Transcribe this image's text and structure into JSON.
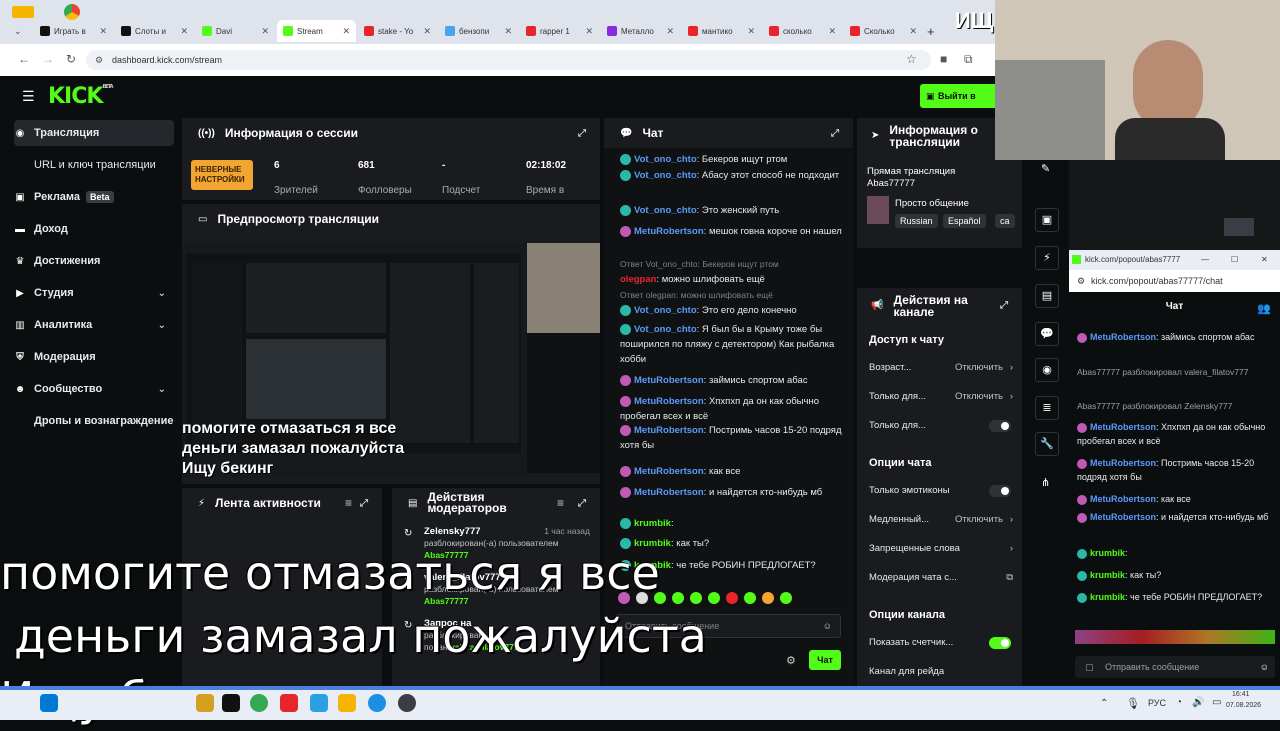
{
  "browser": {
    "tabs": [
      {
        "label": "Играть в",
        "color": "#111"
      },
      {
        "label": "Слоты и",
        "color": "#111"
      },
      {
        "label": "Davi",
        "color": "#53fc18"
      },
      {
        "label": "Stream",
        "color": "#53fc18"
      },
      {
        "label": "stake - Yo",
        "color": "#e8242c"
      },
      {
        "label": "бензопи",
        "color": "#4aa3f0"
      },
      {
        "label": "rapper 1",
        "color": "#e8242c"
      },
      {
        "label": "Металло",
        "color": "#8a2be2"
      },
      {
        "label": "мантико",
        "color": "#e8242c"
      },
      {
        "label": "сколько",
        "color": "#e8242c"
      },
      {
        "label": "Сколько",
        "color": "#e8242c"
      }
    ],
    "url": "dashboard.kick.com/stream",
    "new_tab": "+",
    "overlay_corner_text": "ИЩ"
  },
  "app": {
    "logo": "KICK",
    "logo_beta": "BETA",
    "exit_button": "Выйти в эфи",
    "sidebar": [
      {
        "label": "Трансляция",
        "icon": "broadcast-icon",
        "active": true
      },
      {
        "label": "URL и ключ трансляции",
        "icon": "",
        "active": false
      },
      {
        "label": "Реклама",
        "icon": "ads-icon",
        "badge": "Beta"
      },
      {
        "label": "Доход",
        "icon": "wallet-icon"
      },
      {
        "label": "Достижения",
        "icon": "trophy-icon"
      },
      {
        "label": "Студия",
        "icon": "studio-icon",
        "chevron": true
      },
      {
        "label": "Аналитика",
        "icon": "chart-icon",
        "chevron": true
      },
      {
        "label": "Модерация",
        "icon": "shield-icon"
      },
      {
        "label": "Сообщество",
        "icon": "community-icon",
        "chevron": true
      },
      {
        "label": "Дропы и вознаграждение",
        "icon": ""
      }
    ],
    "session": {
      "title": "Информация о сессии",
      "warning": "НЕВЕРНЫЕ НАСТРОЙКИ",
      "stats": [
        {
          "value": "6",
          "label": "Зрителей"
        },
        {
          "value": "681",
          "label": "Фолловеры"
        },
        {
          "value": "-",
          "label": "Подсчет"
        },
        {
          "value": "02:18:02",
          "label": "Время в"
        }
      ]
    },
    "preview": {
      "title": "Предпросмотр трансляции",
      "caption": "помогите отмазаться я все деньги замазал пожалуйста Ищу бекинг"
    },
    "activity": {
      "title": "Лента активности"
    },
    "modactions": {
      "title": "Действия модераторов",
      "items": [
        {
          "user": "Zelensky777",
          "time": "1 час назад",
          "text": "разблокирован(-а) пользователем",
          "by": "Abas77777"
        },
        {
          "user": "valera_filatov777",
          "time": "",
          "text": "разблокирован(-а) пользователем",
          "by": "Abas77777"
        },
        {
          "user": "Запрос на",
          "time": "",
          "text": "разблокирован",
          "by": "valera_filatov777",
          "prefix": "подан"
        }
      ]
    },
    "chat": {
      "title": "Чат",
      "messages": [
        {
          "user": "Vot_ono_chto",
          "text": "Бекеров ищут ртом",
          "badge": "#2ab8a8"
        },
        {
          "user": "Vot_ono_chto",
          "text": "Абасу этот способ не подходит",
          "badge": "#2ab8a8"
        },
        {
          "user": "Vot_ono_chto",
          "text": "Это женский путь",
          "badge": "#2ab8a8"
        },
        {
          "user": "MetuRobertson",
          "text": "мешок говна короче он нашел",
          "badge": "#c15ab5"
        },
        {
          "sys": "Ответ Vot_ono_chto: Бекеров ищут ртом"
        },
        {
          "user": "olegpan",
          "text": "можно шлифовать ещё",
          "badge": "",
          "color": "#e8242c"
        },
        {
          "sys": "Ответ olegpan: можно шлифовать ещё"
        },
        {
          "user": "Vot_ono_chto",
          "text": "Это его дело конечно",
          "badge": "#2ab8a8"
        },
        {
          "user": "Vot_ono_chto",
          "text": "Я был бы в Крыму тоже бы поширился по пляжу с детектором) Как рыбалка хобби",
          "badge": "#2ab8a8"
        },
        {
          "user": "MetuRobertson",
          "text": "займись спортом абас",
          "badge": "#c15ab5"
        },
        {
          "user": "MetuRobertson",
          "text": "Хпхпхп да он как обычно пробегал всех и всё",
          "badge": "#c15ab5"
        },
        {
          "user": "MetuRobertson",
          "text": "Постримь часов 15-20 подряд хотя бы",
          "badge": "#c15ab5"
        },
        {
          "user": "MetuRobertson",
          "text": "как все",
          "badge": "#c15ab5"
        },
        {
          "user": "MetuRobertson",
          "text": "и найдется кто-нибудь мб",
          "badge": "#c15ab5"
        },
        {
          "user": "krumbik",
          "text": "",
          "badge": "#2ab8a8",
          "color": "#53fc18"
        },
        {
          "user": "krumbik",
          "text": "как ты?",
          "badge": "#2ab8a8",
          "color": "#53fc18"
        },
        {
          "user": "krumbik",
          "text": "че тебе РОБИН ПРЕДЛОГАЕТ?",
          "badge": "#2ab8a8",
          "color": "#53fc18"
        }
      ],
      "send_button": "Чат",
      "input_placeholder": "Отправить сообщение"
    },
    "stream_info": {
      "title": "Информация о трансляции",
      "live_label": "Прямая трансляция",
      "channel": "Abas77777",
      "category": "Просто общение",
      "tags": [
        "Russian",
        "Español",
        "ca"
      ]
    },
    "channel_actions": {
      "title": "Действия на канале",
      "sections": [
        {
          "heading": "Доступ к чату",
          "rows": [
            {
              "label": "Возраст...",
              "value": "Отключить",
              "kind": "chevron"
            },
            {
              "label": "Только для...",
              "value": "Отключить",
              "kind": "chevron"
            },
            {
              "label": "Только для...",
              "value": "",
              "kind": "toggle",
              "on": false
            }
          ]
        },
        {
          "heading": "Опции чата",
          "rows": [
            {
              "label": "Только эмотиконы",
              "value": "",
              "kind": "toggle",
              "on": false
            },
            {
              "label": "Медленный...",
              "value": "Отключить",
              "kind": "chevron"
            },
            {
              "label": "Запрещенные слова",
              "value": "",
              "kind": "chevron"
            },
            {
              "label": "Модерация чата с...",
              "value": "",
              "kind": "external"
            }
          ]
        },
        {
          "heading": "Опции канала",
          "rows": [
            {
              "label": "Показать счетчик...",
              "value": "",
              "kind": "toggle",
              "on": true
            },
            {
              "label": "Канал для рейда",
              "value": "",
              "kind": "none"
            }
          ]
        }
      ]
    }
  },
  "overlay_text": [
    "помогите отмазаться я все",
    "деньги замазал пожалуйста",
    "Ищу бекинг"
  ],
  "popout": {
    "url": "kick.com/popout/abas77777/chat",
    "url_title": "kick.com/popout/abas7777",
    "title": "Чат",
    "messages": [
      {
        "user": "MetuRobertson",
        "text": "займись спортом абас"
      },
      {
        "sys": "Abas77777 разблокировал valera_filatov777"
      },
      {
        "sys": "Abas77777 разблокировал Zelensky777"
      },
      {
        "user": "MetuRobertson",
        "text": "Хпхпхп да он как обычно пробегал всех и всё"
      },
      {
        "user": "MetuRobertson",
        "text": "Постримь часов 15-20 подряд хотя бы"
      },
      {
        "user": "MetuRobertson",
        "text": "как все"
      },
      {
        "user": "MetuRobertson",
        "text": "и найдется кто-нибудь мб"
      },
      {
        "user": "krumbik",
        "text": ""
      },
      {
        "user": "krumbik",
        "text": "как ты?"
      },
      {
        "user": "krumbik",
        "text": "че тебе РОБИН ПРЕДЛОГАЕТ?"
      }
    ],
    "input_placeholder": "Отправить сообщение"
  },
  "taskbar": {
    "lang": "РУС",
    "time": "16:41",
    "date": "07.08.2026"
  },
  "colors": {
    "accent": "#53fc18",
    "panel": "#191b1f",
    "bg": "#0b0e0f"
  }
}
